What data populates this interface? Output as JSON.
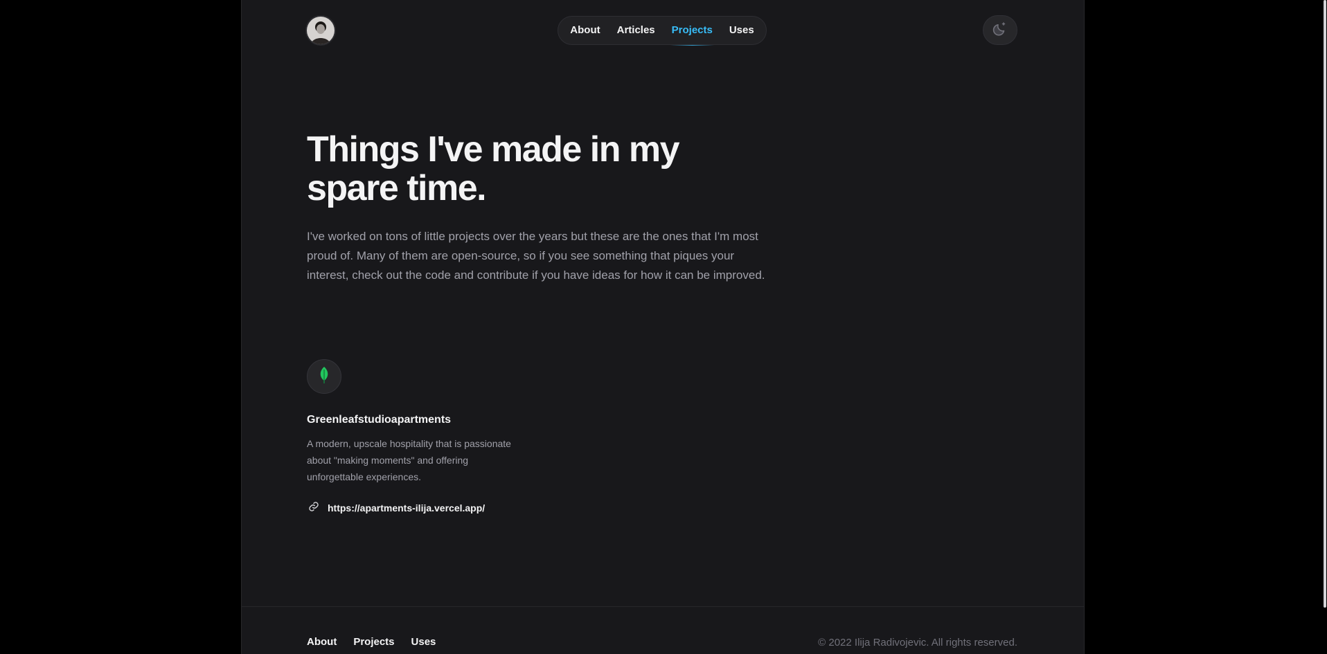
{
  "header": {
    "nav": [
      {
        "label": "About"
      },
      {
        "label": "Articles"
      },
      {
        "label": "Projects"
      },
      {
        "label": "Uses"
      }
    ],
    "active_nav": "Projects",
    "theme_icon": "moon-icon"
  },
  "hero": {
    "title": "Things I've made in my spare time.",
    "intro": "I've worked on tons of little projects over the years but these are the ones that I'm most proud of. Many of them are open-source, so if you see something that piques your interest, check out the code and contribute if you have ideas for how it can be improved."
  },
  "projects": [
    {
      "icon": "leaf-icon",
      "name": "Greenleafstudioapartments",
      "description": "A modern, upscale hospitality that is passionate about \"making moments\" and offering unforgettable experiences.",
      "link": "https://apartments-ilija.vercel.app/"
    }
  ],
  "footer": {
    "nav": [
      {
        "label": "About"
      },
      {
        "label": "Projects"
      },
      {
        "label": "Uses"
      }
    ],
    "copyright": "© 2022 Ilija Radivojevic. All rights reserved."
  },
  "colors": {
    "background": "#18181b",
    "accent": "#38bdf8",
    "leaf": "#22c55e"
  }
}
